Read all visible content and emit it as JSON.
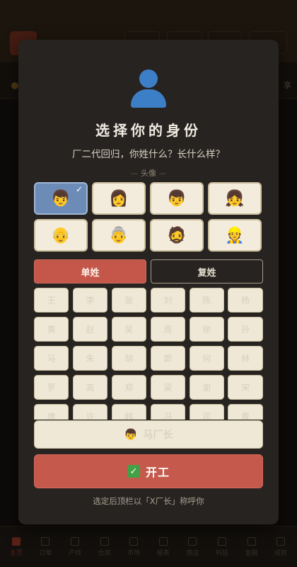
{
  "modal": {
    "title": "选择你的身份",
    "subtitle": "厂二代回归，你姓什么？长什么样？",
    "avatar_section_label": "头像",
    "avatars": [
      {
        "emoji": "👦",
        "selected": true
      },
      {
        "emoji": "👩",
        "selected": false
      },
      {
        "emoji": "👦",
        "selected": false
      },
      {
        "emoji": "👧",
        "selected": false
      },
      {
        "emoji": "👴",
        "selected": false
      },
      {
        "emoji": "👵",
        "selected": false
      },
      {
        "emoji": "🧔",
        "selected": false
      },
      {
        "emoji": "👷",
        "selected": false
      }
    ],
    "check_mark": "✓",
    "surname_type_tabs": [
      {
        "label": "单姓",
        "active": true
      },
      {
        "label": "复姓",
        "active": false
      }
    ],
    "surname_options": [
      "王",
      "李",
      "张",
      "刘",
      "陈",
      "杨",
      "黄",
      "赵",
      "吴",
      "周",
      "徐",
      "孙",
      "马",
      "朱",
      "胡",
      "郭",
      "何",
      "林",
      "罗",
      "高",
      "郑",
      "梁",
      "谢",
      "宋",
      "唐",
      "许",
      "韩",
      "冯",
      "邓",
      "曹"
    ],
    "preview_name": "马厂长",
    "preview_emoji": "👦",
    "start_button_label": "开工",
    "start_button_icon": "✓",
    "hint": "选定后顶栏以「X厂长」称呼你"
  },
  "bottom_nav": {
    "items": [
      {
        "label": "主页",
        "icon": "home-icon",
        "active": true
      },
      {
        "label": "订单",
        "icon": "order-icon",
        "active": false
      },
      {
        "label": "产线",
        "icon": "factory-icon",
        "active": false
      },
      {
        "label": "仓库",
        "icon": "box-icon",
        "active": false
      },
      {
        "label": "市场",
        "icon": "bar-chart-icon",
        "active": false
      },
      {
        "label": "报表",
        "icon": "line-chart-icon",
        "active": false
      },
      {
        "label": "商店",
        "icon": "shop-icon",
        "active": false
      },
      {
        "label": "科技",
        "icon": "atom-icon",
        "active": false
      },
      {
        "label": "金融",
        "icon": "coin-icon",
        "active": false
      },
      {
        "label": "成就",
        "icon": "trophy-icon",
        "active": false
      }
    ]
  },
  "background": {
    "right_stat_text": "享"
  },
  "colors": {
    "accent": "#c55a4c",
    "selected_avatar": "#6c8cb7",
    "person_icon": "#3d7fc7"
  }
}
